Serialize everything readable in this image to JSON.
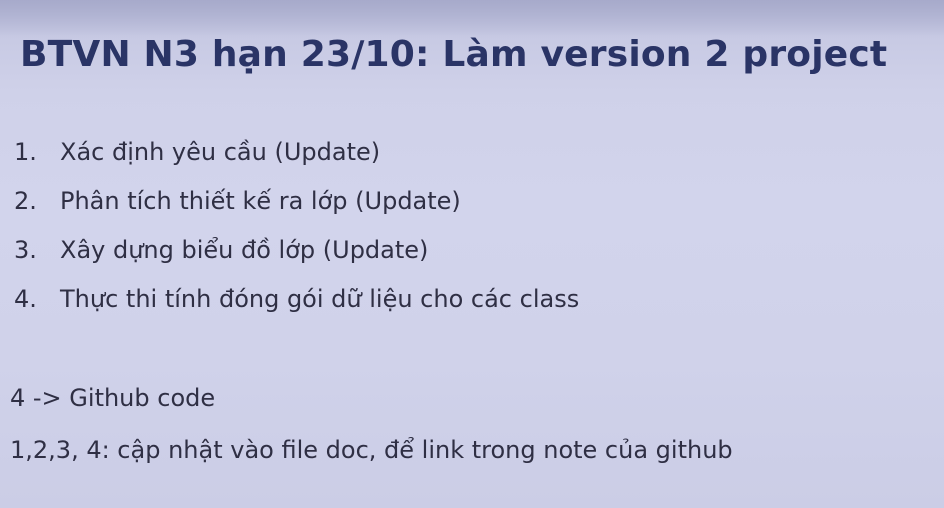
{
  "slide": {
    "title": "BTVN N3 hạn 23/10: Làm version 2 project",
    "tasks": [
      {
        "num": "1.",
        "text": "Xác định yêu cầu (Update)"
      },
      {
        "num": "2.",
        "text": "Phân tích thiết kế ra lớp (Update)"
      },
      {
        "num": "3.",
        "text": "Xây dựng biểu đồ lớp (Update)"
      },
      {
        "num": "4.",
        "text": "Thực thi tính đóng gói dữ liệu cho các class"
      }
    ],
    "note_github": "4 -> Github code",
    "note_doc": "1,2,3, 4: cập nhật vào file doc, để link trong note của github"
  }
}
